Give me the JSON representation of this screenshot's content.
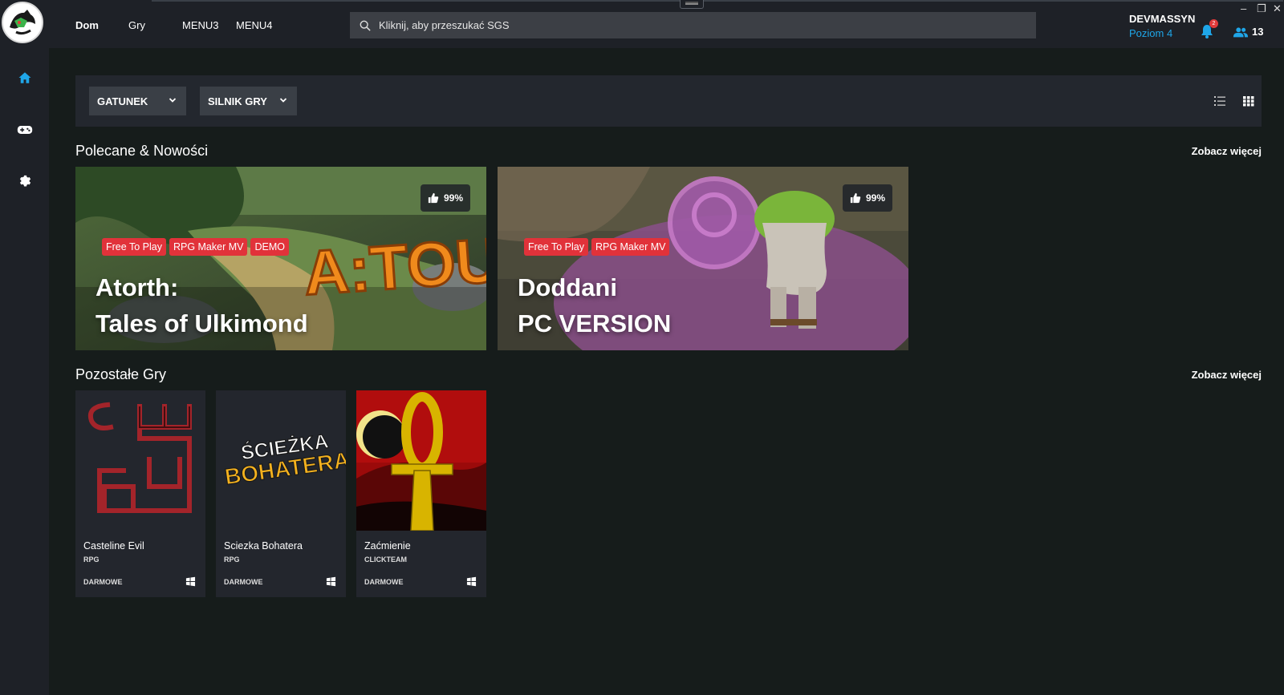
{
  "topbar": {
    "nav": [
      "Dom",
      "Gry",
      "MENU3",
      "MENU4"
    ],
    "search_placeholder": "Kliknij, aby przeszukać SGS",
    "username": "DEVMASSYN",
    "level": "Poziom 4",
    "notifications_count": "2",
    "friends_count": "13",
    "window_controls": [
      "–",
      "❐",
      "✕"
    ]
  },
  "sidebar": {
    "items": [
      {
        "name": "home-icon"
      },
      {
        "name": "gamepad-icon"
      },
      {
        "name": "settings-icon"
      }
    ]
  },
  "filters": {
    "genre_label": "GATUNEK",
    "engine_label": "SILNIK GRY"
  },
  "featured": {
    "title": "Polecane & Nowości",
    "see_more": "Zobacz więcej",
    "items": [
      {
        "title_line1": "Atorth:",
        "title_line2": "Tales of Ulkimond",
        "tags": [
          "Free To Play",
          "RPG Maker MV",
          "DEMO"
        ],
        "rating": "99%",
        "logo_text": "A:TOU"
      },
      {
        "title_line1": "Doddani",
        "title_line2": "PC VERSION",
        "tags": [
          "Free To Play",
          "RPG Maker MV"
        ],
        "rating": "99%"
      }
    ]
  },
  "other_games": {
    "title": "Pozostałe Gry",
    "see_more": "Zobacz więcej",
    "items": [
      {
        "title": "Casteline Evil",
        "genre": "RPG",
        "price": "DARMOWE"
      },
      {
        "title": "Sciezka Bohatera",
        "genre": "RPG",
        "price": "DARMOWE",
        "art_line1": "ŚCIEŻKA",
        "art_line2": "BOHATERA"
      },
      {
        "title": "Zaćmienie",
        "genre": "CLICKTEAM",
        "price": "DARMOWE"
      }
    ]
  },
  "colors": {
    "accent_blue": "#1fa6e8",
    "tag_red": "#e1323a",
    "page_bg": "#161c1b",
    "panel_bg": "#1e2127"
  }
}
